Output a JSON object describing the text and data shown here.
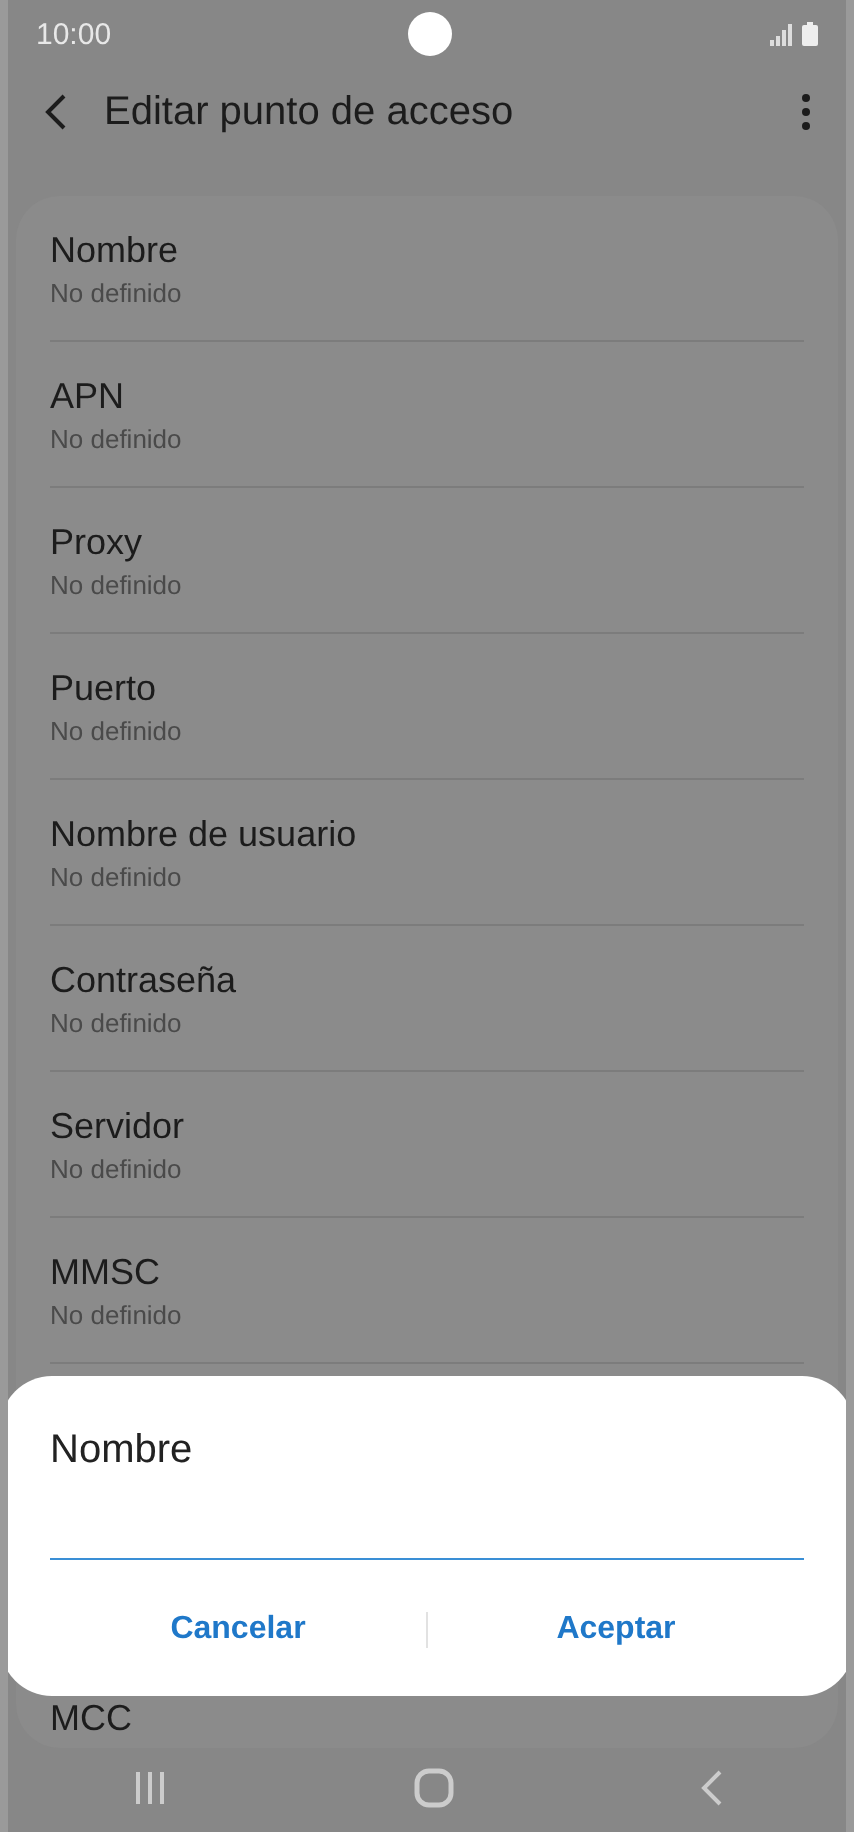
{
  "status_bar": {
    "time": "10:00"
  },
  "header": {
    "title": "Editar punto de acceso"
  },
  "fields": [
    {
      "title": "Nombre",
      "value": "No definido"
    },
    {
      "title": "APN",
      "value": "No definido"
    },
    {
      "title": "Proxy",
      "value": "No definido"
    },
    {
      "title": "Puerto",
      "value": "No definido"
    },
    {
      "title": "Nombre de usuario",
      "value": "No definido"
    },
    {
      "title": "Contraseña",
      "value": "No definido"
    },
    {
      "title": "Servidor",
      "value": "No definido"
    },
    {
      "title": "MMSC",
      "value": "No definido"
    },
    {
      "title": "MCC"
    }
  ],
  "dialog": {
    "title": "Nombre",
    "buttons": [
      "Cancelar",
      "Aceptar"
    ]
  }
}
